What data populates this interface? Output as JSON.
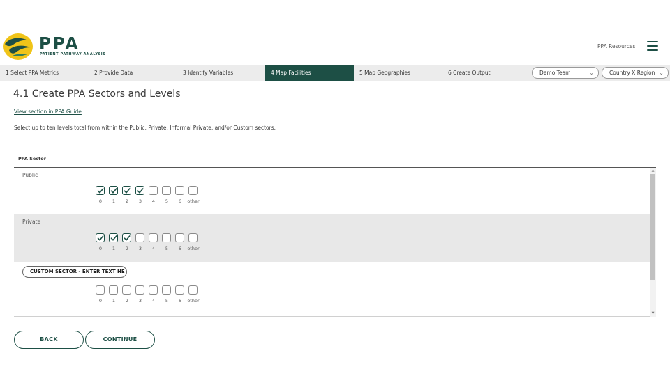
{
  "app": {
    "title": "PPA",
    "subtitle": "PATIENT PATHWAY ANALYSIS"
  },
  "header": {
    "resources_label": "PPA Resources"
  },
  "steps": [
    {
      "label": "1 Select PPA Metrics",
      "active": false
    },
    {
      "label": "2 Provide Data",
      "active": false
    },
    {
      "label": "3 Identify Variables",
      "active": false
    },
    {
      "label": "4 Map Facilities",
      "active": true
    },
    {
      "label": "5 Map Geographies",
      "active": false
    },
    {
      "label": "6 Create Output",
      "active": false
    }
  ],
  "team_select": {
    "value": "Demo Team"
  },
  "region_select": {
    "value": "Country X Region"
  },
  "main": {
    "title": "4.1 Create PPA Sectors and Levels",
    "guide_link": "View section in PPA Guide",
    "instructions": "Select up to ten levels total from within the Public, Private, Informal Private, and/or Custom sectors.",
    "table_header": "PPA Sector"
  },
  "level_labels": [
    "0",
    "1",
    "2",
    "3",
    "4",
    "5",
    "6",
    "other"
  ],
  "sectors": [
    {
      "name": "Public",
      "checked": [
        true,
        true,
        true,
        true,
        false,
        false,
        false,
        false
      ]
    },
    {
      "name": "Private",
      "checked": [
        true,
        true,
        true,
        false,
        false,
        false,
        false,
        false
      ]
    },
    {
      "name": "CUSTOM SECTOR - ENTER TEXT HE",
      "checked": [
        false,
        false,
        false,
        false,
        false,
        false,
        false,
        false
      ]
    }
  ],
  "buttons": {
    "back": "BACK",
    "continue": "CONTINUE"
  },
  "colors": {
    "brand": "#1d4f45",
    "accent_yellow": "#f0c419",
    "row_grey": "#e8e8e8"
  }
}
